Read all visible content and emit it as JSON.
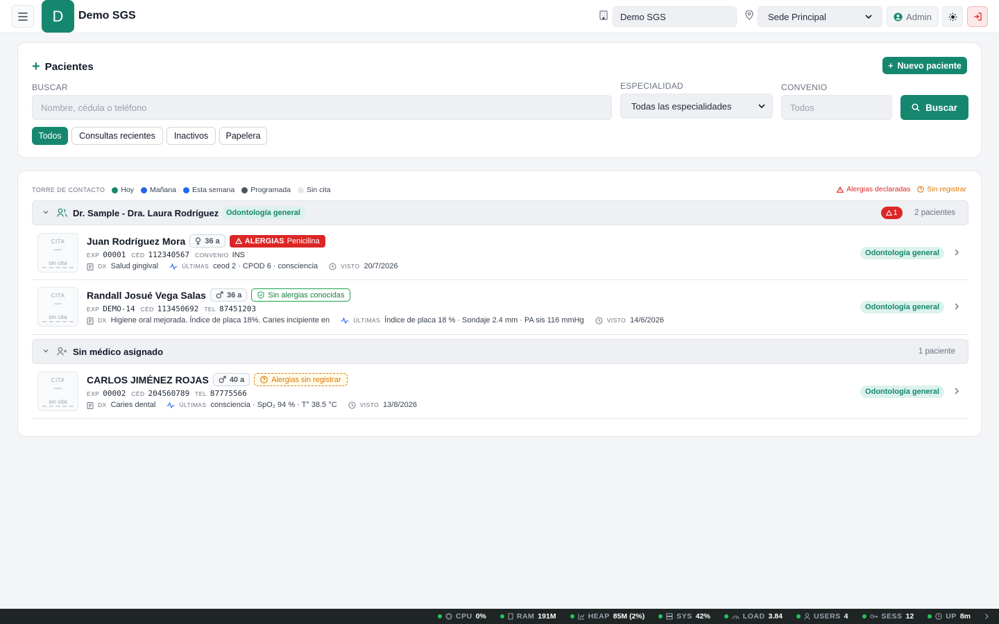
{
  "header": {
    "logo_letter": "D",
    "app_title": "Demo SGS",
    "tenant_value": "Demo SGS",
    "sede_value": "Sede Principal",
    "admin_label": "Admin"
  },
  "search_card": {
    "title": "Pacientes",
    "new_patient_label": "Nuevo paciente",
    "search_label": "BUSCAR",
    "search_placeholder": "Nombre, cédula o teléfono",
    "specialty_label": "ESPECIALIDAD",
    "specialty_value": "Todas las especialidades",
    "convenio_label": "CONVENIO",
    "convenio_placeholder": "Todos",
    "search_button": "Buscar",
    "filters": [
      "Todos",
      "Consultas recientes",
      "Inactivos",
      "Papelera"
    ]
  },
  "legend": {
    "title": "TORRE DE CONTACTO",
    "items": [
      {
        "label": "Hoy",
        "color": "#15876f"
      },
      {
        "label": "Mañana",
        "color": "#2563eb"
      },
      {
        "label": "Esta semana",
        "color": "#1e66f5"
      },
      {
        "label": "Programada",
        "color": "#4b5563"
      },
      {
        "label": "Sin cita",
        "color": "#e5e7eb"
      }
    ],
    "alergias_declaradas": "Alergias declaradas",
    "sin_registrar": "Sin registrar"
  },
  "groups": [
    {
      "name": "Dr. Sample - Dra. Laura Rodríguez",
      "specialty": "Odontología general",
      "alert_count": "1",
      "count": "2 pacientes",
      "patients": [
        {
          "cita_label": "CITA",
          "cita_dash": "—",
          "cita_status": "sin cita",
          "name": "Juan Rodríguez Mora",
          "sex_age": "36 a",
          "allergy_prefix": "ALERGIAS",
          "allergy_text": "Penicilina",
          "exp_label": "EXP",
          "exp": "00001",
          "ced_label": "CÉD",
          "ced": "112340567",
          "extra_label": "CONVENIO",
          "extra": "INS",
          "dx_label": "DX",
          "dx": "Salud gingival",
          "ult_label": "ÚLTIMAS",
          "ult": "ceod 2 · CPOD 6 · consciencia",
          "visto_label": "VISTO",
          "visto": "20/7/2026",
          "specialty": "Odontología general"
        },
        {
          "cita_label": "CITA",
          "cita_dash": "—",
          "cita_status": "sin cita",
          "name": "Randall Josué Vega Salas",
          "sex_age": "36 a",
          "allergy_text": "Sin alergias conocidas",
          "exp_label": "EXP",
          "exp": "DEMO-14",
          "ced_label": "CÉD",
          "ced": "113450692",
          "extra_label": "TEL",
          "extra": "87451203",
          "dx_label": "DX",
          "dx": "Higiene oral mejorada. Índice de placa 18%. Caries incipiente en",
          "ult_label": "ÚLTIMAS",
          "ult": "Índice de placa 18 % · Sondaje 2.4 mm · PA sis 116 mmHg",
          "visto_label": "VISTO",
          "visto": "14/6/2026",
          "specialty": "Odontología general"
        }
      ]
    },
    {
      "name": "Sin médico asignado",
      "count": "1 paciente",
      "patients": [
        {
          "cita_label": "CITA",
          "cita_dash": "—",
          "cita_status": "sin cita",
          "name": "CARLOS JIMÉNEZ ROJAS",
          "sex_age": "40 a",
          "allergy_text": "Alergias sin registrar",
          "exp_label": "EXP",
          "exp": "00002",
          "ced_label": "CÉD",
          "ced": "204560789",
          "extra_label": "TEL",
          "extra": "87775566",
          "dx_label": "DX",
          "dx": "Caries dental",
          "ult_label": "ÚLTIMAS",
          "ult": "consciencia · SpO₂ 94 % · T° 38.5 °C",
          "visto_label": "VISTO",
          "visto": "13/8/2026",
          "specialty": "Odontología general"
        }
      ]
    }
  ],
  "statusbar": [
    {
      "label": "CPU",
      "value": "0%",
      "icon": "cpu-icon"
    },
    {
      "label": "RAM",
      "value": "191M",
      "icon": "memory-icon"
    },
    {
      "label": "HEAP",
      "value": "85M (2%)",
      "icon": "chart-icon"
    },
    {
      "label": "SYS",
      "value": "42%",
      "icon": "server-icon"
    },
    {
      "label": "LOAD",
      "value": "3.84",
      "icon": "gauge-icon"
    },
    {
      "label": "USERS",
      "value": "4",
      "icon": "user-icon"
    },
    {
      "label": "SESS",
      "value": "12",
      "icon": "key-icon"
    },
    {
      "label": "UP",
      "value": "8m",
      "icon": "clock-icon"
    }
  ],
  "colors": {
    "accent": "#15876f",
    "danger": "#dc2626",
    "warning": "#d97706",
    "success": "#16a34a"
  }
}
